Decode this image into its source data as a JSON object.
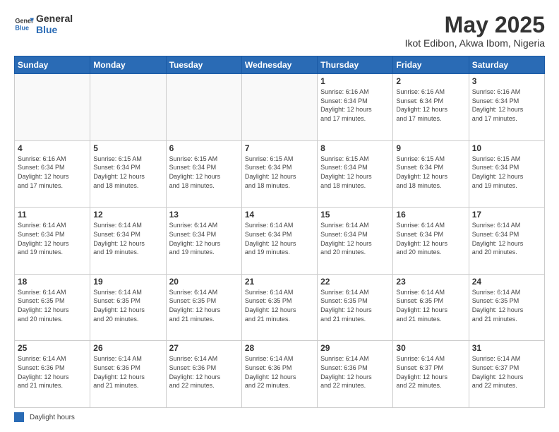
{
  "logo": {
    "general": "General",
    "blue": "Blue"
  },
  "title": "May 2025",
  "subtitle": "Ikot Edibon, Akwa Ibom, Nigeria",
  "weekdays": [
    "Sunday",
    "Monday",
    "Tuesday",
    "Wednesday",
    "Thursday",
    "Friday",
    "Saturday"
  ],
  "footer_legend": "Daylight hours",
  "weeks": [
    [
      {
        "day": "",
        "info": ""
      },
      {
        "day": "",
        "info": ""
      },
      {
        "day": "",
        "info": ""
      },
      {
        "day": "",
        "info": ""
      },
      {
        "day": "1",
        "info": "Sunrise: 6:16 AM\nSunset: 6:34 PM\nDaylight: 12 hours\nand 17 minutes."
      },
      {
        "day": "2",
        "info": "Sunrise: 6:16 AM\nSunset: 6:34 PM\nDaylight: 12 hours\nand 17 minutes."
      },
      {
        "day": "3",
        "info": "Sunrise: 6:16 AM\nSunset: 6:34 PM\nDaylight: 12 hours\nand 17 minutes."
      }
    ],
    [
      {
        "day": "4",
        "info": "Sunrise: 6:16 AM\nSunset: 6:34 PM\nDaylight: 12 hours\nand 17 minutes."
      },
      {
        "day": "5",
        "info": "Sunrise: 6:15 AM\nSunset: 6:34 PM\nDaylight: 12 hours\nand 18 minutes."
      },
      {
        "day": "6",
        "info": "Sunrise: 6:15 AM\nSunset: 6:34 PM\nDaylight: 12 hours\nand 18 minutes."
      },
      {
        "day": "7",
        "info": "Sunrise: 6:15 AM\nSunset: 6:34 PM\nDaylight: 12 hours\nand 18 minutes."
      },
      {
        "day": "8",
        "info": "Sunrise: 6:15 AM\nSunset: 6:34 PM\nDaylight: 12 hours\nand 18 minutes."
      },
      {
        "day": "9",
        "info": "Sunrise: 6:15 AM\nSunset: 6:34 PM\nDaylight: 12 hours\nand 18 minutes."
      },
      {
        "day": "10",
        "info": "Sunrise: 6:15 AM\nSunset: 6:34 PM\nDaylight: 12 hours\nand 19 minutes."
      }
    ],
    [
      {
        "day": "11",
        "info": "Sunrise: 6:14 AM\nSunset: 6:34 PM\nDaylight: 12 hours\nand 19 minutes."
      },
      {
        "day": "12",
        "info": "Sunrise: 6:14 AM\nSunset: 6:34 PM\nDaylight: 12 hours\nand 19 minutes."
      },
      {
        "day": "13",
        "info": "Sunrise: 6:14 AM\nSunset: 6:34 PM\nDaylight: 12 hours\nand 19 minutes."
      },
      {
        "day": "14",
        "info": "Sunrise: 6:14 AM\nSunset: 6:34 PM\nDaylight: 12 hours\nand 19 minutes."
      },
      {
        "day": "15",
        "info": "Sunrise: 6:14 AM\nSunset: 6:34 PM\nDaylight: 12 hours\nand 20 minutes."
      },
      {
        "day": "16",
        "info": "Sunrise: 6:14 AM\nSunset: 6:34 PM\nDaylight: 12 hours\nand 20 minutes."
      },
      {
        "day": "17",
        "info": "Sunrise: 6:14 AM\nSunset: 6:34 PM\nDaylight: 12 hours\nand 20 minutes."
      }
    ],
    [
      {
        "day": "18",
        "info": "Sunrise: 6:14 AM\nSunset: 6:35 PM\nDaylight: 12 hours\nand 20 minutes."
      },
      {
        "day": "19",
        "info": "Sunrise: 6:14 AM\nSunset: 6:35 PM\nDaylight: 12 hours\nand 20 minutes."
      },
      {
        "day": "20",
        "info": "Sunrise: 6:14 AM\nSunset: 6:35 PM\nDaylight: 12 hours\nand 21 minutes."
      },
      {
        "day": "21",
        "info": "Sunrise: 6:14 AM\nSunset: 6:35 PM\nDaylight: 12 hours\nand 21 minutes."
      },
      {
        "day": "22",
        "info": "Sunrise: 6:14 AM\nSunset: 6:35 PM\nDaylight: 12 hours\nand 21 minutes."
      },
      {
        "day": "23",
        "info": "Sunrise: 6:14 AM\nSunset: 6:35 PM\nDaylight: 12 hours\nand 21 minutes."
      },
      {
        "day": "24",
        "info": "Sunrise: 6:14 AM\nSunset: 6:35 PM\nDaylight: 12 hours\nand 21 minutes."
      }
    ],
    [
      {
        "day": "25",
        "info": "Sunrise: 6:14 AM\nSunset: 6:36 PM\nDaylight: 12 hours\nand 21 minutes."
      },
      {
        "day": "26",
        "info": "Sunrise: 6:14 AM\nSunset: 6:36 PM\nDaylight: 12 hours\nand 21 minutes."
      },
      {
        "day": "27",
        "info": "Sunrise: 6:14 AM\nSunset: 6:36 PM\nDaylight: 12 hours\nand 22 minutes."
      },
      {
        "day": "28",
        "info": "Sunrise: 6:14 AM\nSunset: 6:36 PM\nDaylight: 12 hours\nand 22 minutes."
      },
      {
        "day": "29",
        "info": "Sunrise: 6:14 AM\nSunset: 6:36 PM\nDaylight: 12 hours\nand 22 minutes."
      },
      {
        "day": "30",
        "info": "Sunrise: 6:14 AM\nSunset: 6:37 PM\nDaylight: 12 hours\nand 22 minutes."
      },
      {
        "day": "31",
        "info": "Sunrise: 6:14 AM\nSunset: 6:37 PM\nDaylight: 12 hours\nand 22 minutes."
      }
    ]
  ]
}
